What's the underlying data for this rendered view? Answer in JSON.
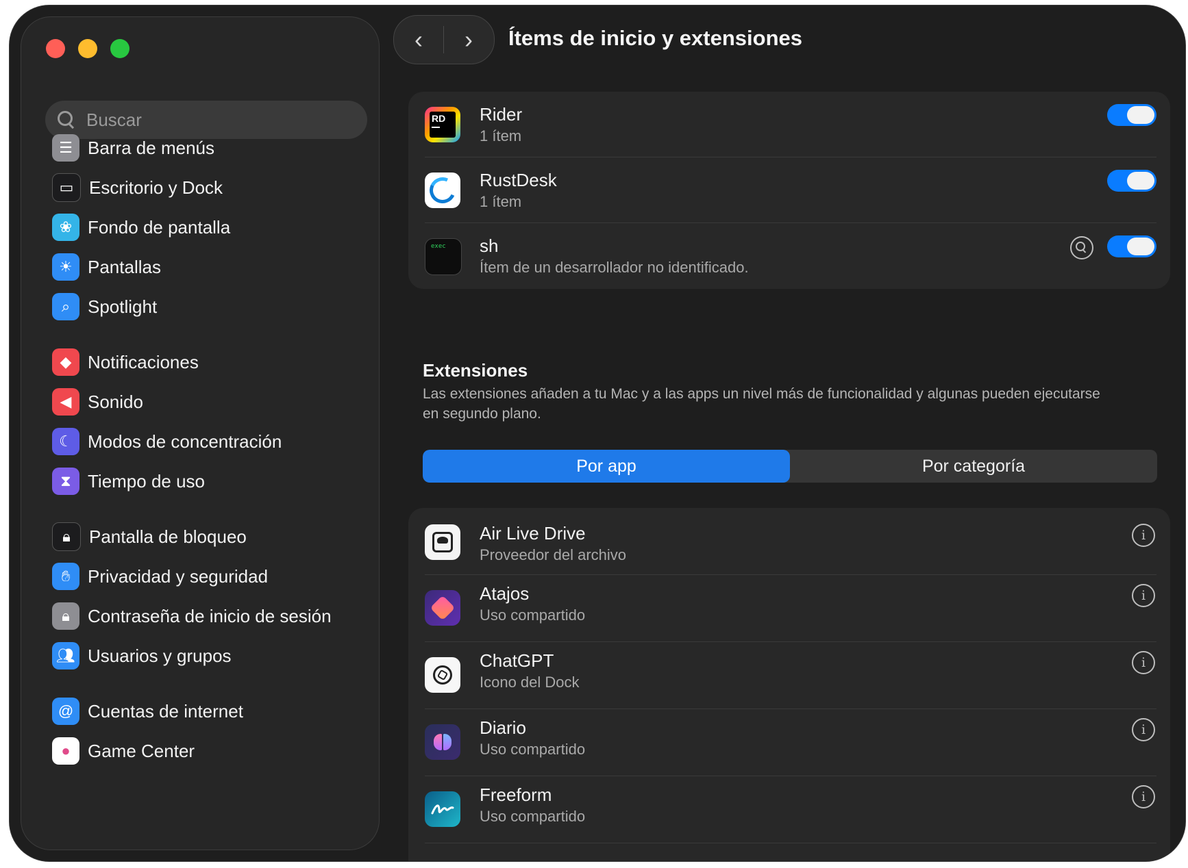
{
  "colors": {
    "close": "#ff5f57",
    "minimize": "#febc2e",
    "zoom": "#28c840",
    "accent": "#0a7cff"
  },
  "sidebar": {
    "search_placeholder": "Buscar",
    "items": [
      {
        "label": "Barra de menús",
        "icon": "menu-bar-icon",
        "color": "#8e8e93",
        "glyph": "☰"
      },
      {
        "label": "Escritorio y Dock",
        "icon": "desktop-dock-icon",
        "color": "#1c1c1e",
        "glyph": "▭"
      },
      {
        "label": "Fondo de pantalla",
        "icon": "wallpaper-icon",
        "color": "#34b4e8",
        "glyph": "❀"
      },
      {
        "label": "Pantallas",
        "icon": "displays-icon",
        "color": "#2f8df6",
        "glyph": "☀"
      },
      {
        "label": "Spotlight",
        "icon": "spotlight-icon",
        "color": "#2f8df6",
        "glyph": "⌕"
      },
      {
        "label": "Notificaciones",
        "icon": "notifications-icon",
        "color": "#f0484e",
        "glyph": "◆"
      },
      {
        "label": "Sonido",
        "icon": "sound-icon",
        "color": "#f0484e",
        "glyph": "◀"
      },
      {
        "label": "Modos de concentración",
        "icon": "focus-icon",
        "color": "#5e5ce6",
        "glyph": "☾"
      },
      {
        "label": "Tiempo de uso",
        "icon": "screen-time-icon",
        "color": "#7b5ce6",
        "glyph": "⧗"
      },
      {
        "label": "Pantalla de bloqueo",
        "icon": "lock-screen-icon",
        "color": "#1c1c1e",
        "glyph": "🔒︎"
      },
      {
        "label": "Privacidad y seguridad",
        "icon": "privacy-hand-icon",
        "color": "#2f8df6",
        "glyph": "✋︎"
      },
      {
        "label": "Contraseña de inicio de sesión",
        "icon": "login-password-icon",
        "color": "#8e8e93",
        "glyph": "🔒︎"
      },
      {
        "label": "Usuarios y grupos",
        "icon": "users-groups-icon",
        "color": "#2f8df6",
        "glyph": "👥︎"
      },
      {
        "label": "Cuentas de internet",
        "icon": "internet-accounts-icon",
        "color": "#2f8df6",
        "glyph": "@"
      },
      {
        "label": "Game Center",
        "icon": "game-center-icon",
        "color": "#ffffff",
        "glyph": "●"
      }
    ]
  },
  "header": {
    "title": "Ítems de inicio y extensiones",
    "back_glyph": "‹",
    "forward_glyph": "›"
  },
  "login_items": [
    {
      "name": "Rider",
      "sub": "1 ítem",
      "icon": "rider-app-icon",
      "enabled": true
    },
    {
      "name": "RustDesk",
      "sub": "1 ítem",
      "icon": "rustdesk-app-icon",
      "enabled": true
    },
    {
      "name": "sh",
      "sub": "Ítem de un desarrollador no identificado.",
      "icon": "exec-terminal-icon",
      "enabled": true
    }
  ],
  "extensions": {
    "title": "Extensiones",
    "description": "Las extensiones añaden a tu Mac y a las apps un nivel más de funcionalidad y algunas pueden ejecutarse en segundo plano.",
    "tabs": [
      "Por app",
      "Por categoría"
    ],
    "active_tab": 0,
    "items": [
      {
        "name": "Air Live Drive",
        "sub": "Proveedor del archivo",
        "icon": "air-live-drive-icon"
      },
      {
        "name": "Atajos",
        "sub": "Uso compartido",
        "icon": "shortcuts-icon"
      },
      {
        "name": "ChatGPT",
        "sub": "Icono del Dock",
        "icon": "chatgpt-icon"
      },
      {
        "name": "Diario",
        "sub": "Uso compartido",
        "icon": "journal-icon"
      },
      {
        "name": "Freeform",
        "sub": "Uso compartido",
        "icon": "freeform-icon"
      }
    ]
  },
  "labels": {
    "rider_badge": "RD",
    "exec_badge": "exec",
    "info_glyph": "i"
  }
}
